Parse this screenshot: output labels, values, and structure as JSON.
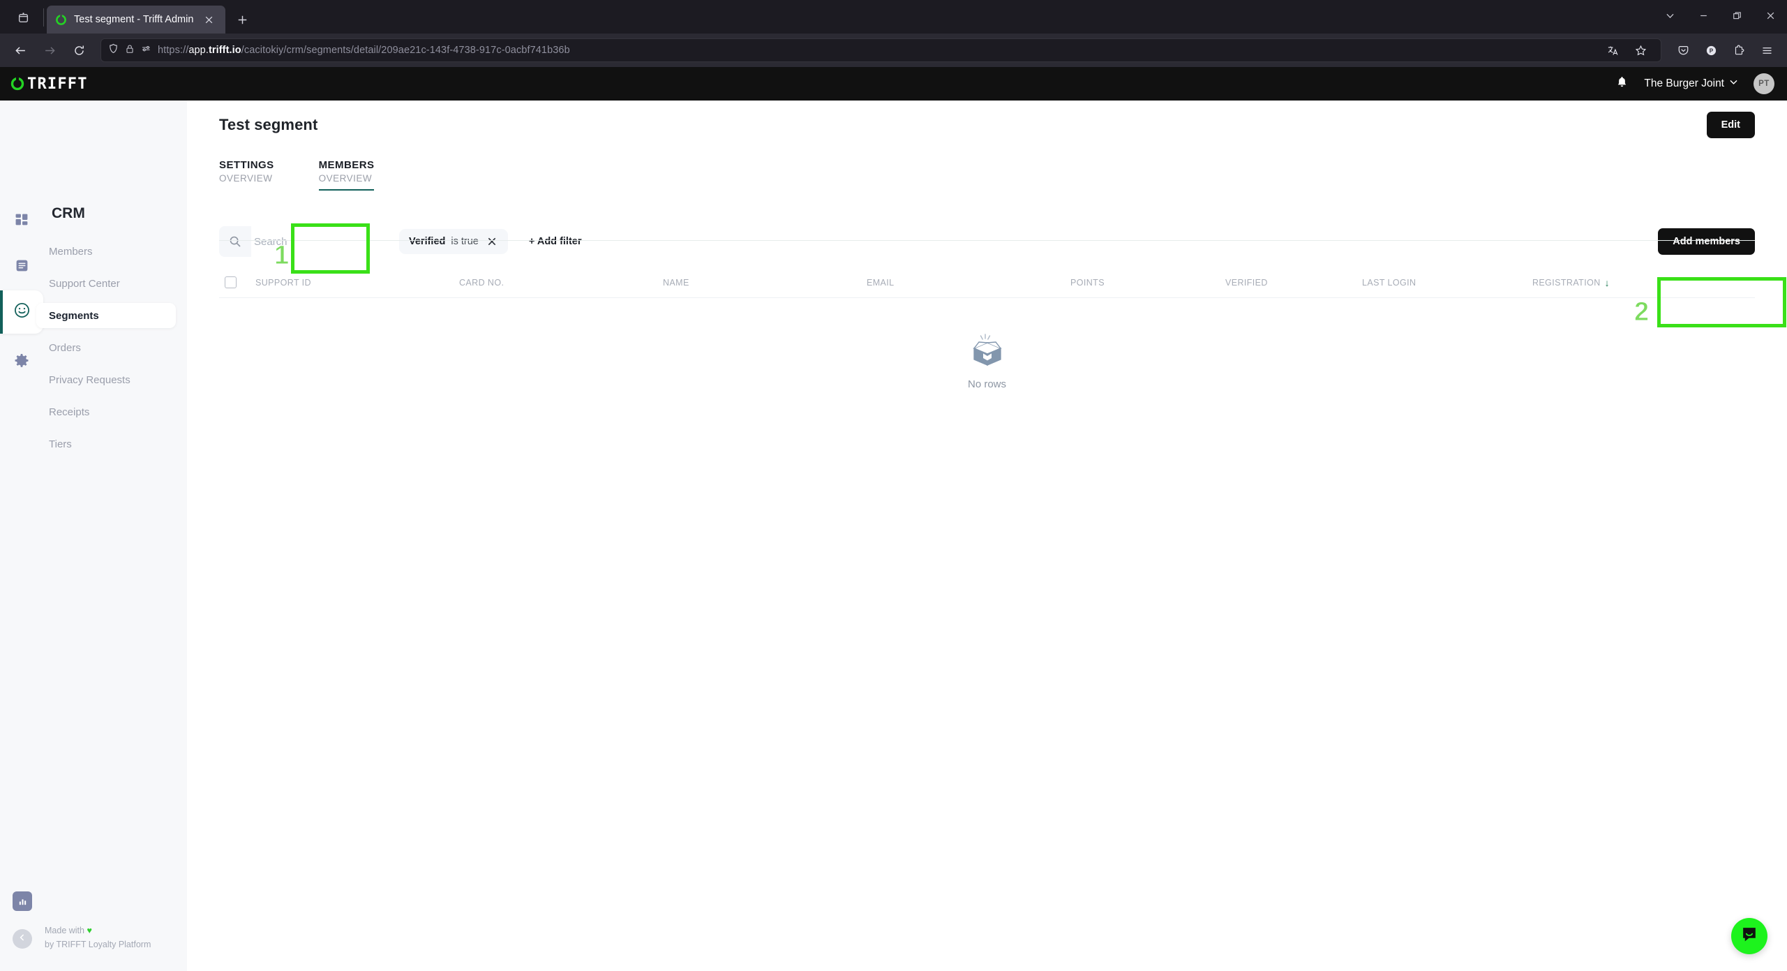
{
  "browser": {
    "tab": {
      "title": "Test segment - Trifft Admin",
      "favicon": "trifft-logo-icon",
      "close": "×"
    },
    "new_tab_label": "+",
    "url": {
      "scheme": "https://",
      "host_pre": "app.",
      "host_bold": "trifft.io",
      "path": "/cacitokiy/crm/segments/detail/209ae21c-143f-4738-917c-0acbf741b36b",
      "full": "https://app.trifft.io/cacitokiy/crm/segments/detail/209ae21c-143f-4738-917c-0acbf741b36b"
    },
    "nav": {
      "back": "back-icon",
      "forward": "forward-icon",
      "reload": "reload-icon"
    },
    "urlbar_icons": [
      "shield-icon",
      "lock-icon",
      "permissions-icon"
    ],
    "urlbar_right_icons": [
      "translate-icon",
      "bookmark-star-icon"
    ],
    "toolbar_right_icons": [
      "pocket-icon",
      "profile-icon",
      "extensions-icon",
      "menu-icon"
    ],
    "window_controls": [
      "list-all-tabs-icon",
      "minimize-icon",
      "restore-icon",
      "close-icon"
    ]
  },
  "app_header": {
    "brand": "TRIFFT",
    "notifications": "bell-icon",
    "tenant": "The Burger Joint",
    "tenant_chevron": "chevron-down-icon",
    "avatar_initials": "PT"
  },
  "sidebar": {
    "section_title": "CRM",
    "rail": [
      {
        "name": "dashboard-icon",
        "active": false
      },
      {
        "name": "content-icon",
        "active": false
      },
      {
        "name": "crm-smiley-icon",
        "active": true
      },
      {
        "name": "settings-gear-icon",
        "active": false
      }
    ],
    "items": [
      {
        "label": "Members",
        "active": false
      },
      {
        "label": "Support Center",
        "active": false
      },
      {
        "label": "Segments",
        "active": true
      },
      {
        "label": "Orders",
        "active": false
      },
      {
        "label": "Privacy Requests",
        "active": false
      },
      {
        "label": "Receipts",
        "active": false
      },
      {
        "label": "Tiers",
        "active": false
      }
    ],
    "footer": {
      "stat_icon": "analytics-icon",
      "collapse_icon": "chevron-left-icon",
      "line1_pre": "Made with ",
      "line1_heart": "♥",
      "line2": "by TRIFFT Loyalty Platform"
    }
  },
  "page": {
    "title": "Test segment",
    "edit_label": "Edit",
    "tabs": [
      {
        "line1": "SETTINGS",
        "line2": "OVERVIEW",
        "active": false
      },
      {
        "line1": "MEMBERS",
        "line2": "OVERVIEW",
        "active": true
      }
    ]
  },
  "toolbar": {
    "search_icon": "search-icon",
    "search_value": "",
    "search_placeholder": "Search",
    "filter_chip": {
      "field": "Verified",
      "operator": "is true",
      "remove": "×"
    },
    "add_filter_label": "+ Add filter",
    "add_members_label": "Add members"
  },
  "table": {
    "select_all": "select-all-checkbox",
    "columns": [
      {
        "label": "SUPPORT ID",
        "sorted": false
      },
      {
        "label": "CARD NO.",
        "sorted": false
      },
      {
        "label": "NAME",
        "sorted": false
      },
      {
        "label": "EMAIL",
        "sorted": false
      },
      {
        "label": "POINTS",
        "sorted": false
      },
      {
        "label": "VERIFIED",
        "sorted": false
      },
      {
        "label": "LAST LOGIN",
        "sorted": false
      },
      {
        "label": "REGISTRATION",
        "sorted": true,
        "sort_dir": "↓"
      }
    ],
    "rows": [],
    "empty_icon": "empty-box-icon",
    "empty_label": "No rows"
  },
  "chat": {
    "icon": "chat-bubble-icon"
  },
  "annotations": [
    {
      "number": "1",
      "target": "members-tab"
    },
    {
      "number": "2",
      "target": "add-members-button"
    }
  ],
  "colors": {
    "brand_green": "#2fcf2f",
    "annotation_green": "#3ae018",
    "accent_teal": "#12605a",
    "dark_button": "#111111"
  }
}
